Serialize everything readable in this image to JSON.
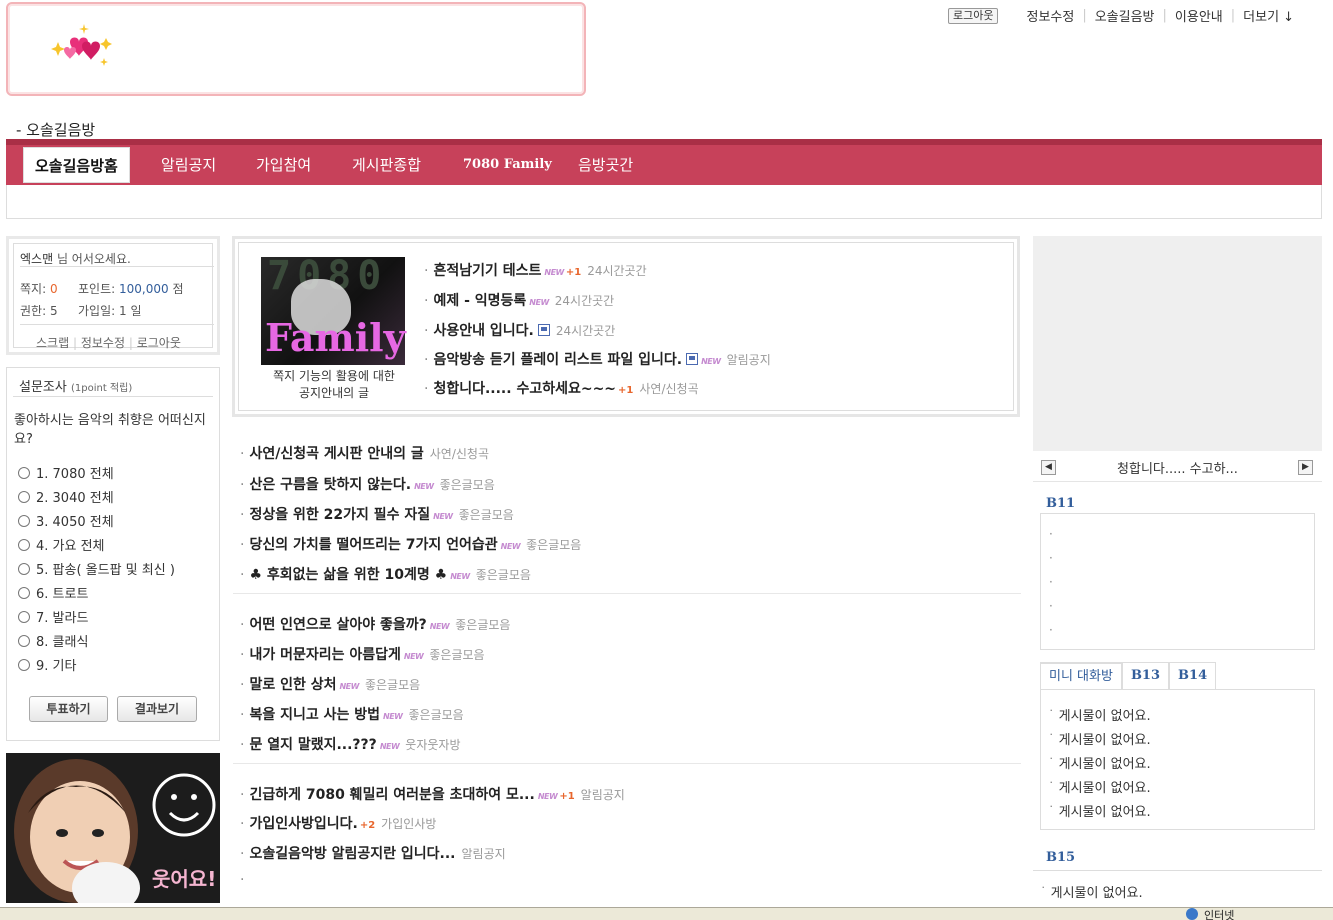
{
  "topnav": {
    "logout": "로그아웃",
    "links": [
      "정보수정",
      "오솔길음방",
      "이용안내",
      "더보기 ↓"
    ]
  },
  "cafe_title": "- 오솔길음방",
  "menu": [
    "오솔길음방홈",
    "알림공지",
    "가입참여",
    "게시판종합",
    "7080 Family",
    "음방곳간"
  ],
  "login": {
    "greeting_name": "엑스맨",
    "greeting_rest": " 님 어서오세요.",
    "note_label": "쪽지:",
    "note_value": "0",
    "point_label": "포인트:",
    "point_value": "100,000",
    "point_unit": "점",
    "rank_label": "권한:",
    "rank_value": "5",
    "join_label": "가입일:",
    "join_value": "1 일",
    "links": [
      "스크랩",
      "정보수정",
      "로그아웃"
    ]
  },
  "poll": {
    "title": "설문조사",
    "title_note": "(1point 적립)",
    "question": "좋아하시는 음악의 취향은 어떠신지요?",
    "options": [
      "1. 7080 전체",
      "2. 3040 전체",
      "3. 4050 전체",
      "4. 가요 전체",
      "5. 팝송( 올드팝 및 최신 )",
      "6. 트로트",
      "7. 발라드",
      "8. 클래식",
      "9. 기타"
    ],
    "vote_button": "투표하기",
    "result_button": "결과보기"
  },
  "smile_caption": "웃어요!",
  "family_image": {
    "line1": "7080",
    "line2": "Family",
    "caption": "쪽지 기능의 활용에 대한 공지안내의 글"
  },
  "notice_posts": [
    {
      "title": "흔적남기기 테스트",
      "new": "NEW",
      "count": "+1",
      "category": "24시간곳간"
    },
    {
      "title": "예제 - 익명등록",
      "new": "NEW",
      "count": "",
      "category": "24시간곳간"
    },
    {
      "title": "사용안내 입니다.",
      "new": "",
      "count": "",
      "category": "24시간곳간"
    },
    {
      "title": "음악방송 듣기 플레이 리스트 파일 입니다.",
      "new": "NEW",
      "count": "",
      "category": "알림공지"
    },
    {
      "title": "청합니다..... 수고하세요~~~",
      "new": "",
      "count": "+1",
      "category": "사연/신청곡"
    }
  ],
  "list1": [
    {
      "title": "사연/신청곡 게시판 안내의 글",
      "new": "",
      "count": "",
      "category": "사연/신청곡"
    },
    {
      "title": "산은 구름을 탓하지 않는다.",
      "new": "NEW",
      "count": "",
      "category": "좋은글모음"
    },
    {
      "title": "정상을 위한 22가지 필수 자질",
      "new": "NEW",
      "count": "",
      "category": "좋은글모음"
    },
    {
      "title": "당신의 가치를 떨어뜨리는 7가지 언어습관",
      "new": "NEW",
      "count": "",
      "category": "좋은글모음"
    },
    {
      "title": "♣ 후회없는 삶을 위한 10계명 ♣",
      "new": "NEW",
      "count": "",
      "category": "좋은글모음"
    }
  ],
  "list2": [
    {
      "title": "어떤 인연으로 살아야 좋을까?",
      "new": "NEW",
      "count": "",
      "category": "좋은글모음"
    },
    {
      "title": "내가 머문자리는 아름답게",
      "new": "NEW",
      "count": "",
      "category": "좋은글모음"
    },
    {
      "title": "말로 인한 상처",
      "new": "NEW",
      "count": "",
      "category": "좋은글모음"
    },
    {
      "title": "복을 지니고 사는 방법",
      "new": "NEW",
      "count": "",
      "category": "좋은글모음"
    },
    {
      "title": "문 열지 말랬지...???",
      "new": "NEW",
      "count": "",
      "category": "웃자웃자방"
    }
  ],
  "list3": [
    {
      "title": "긴급하게 7080 훼밀리 여러분을 초대하여 모...",
      "new": "NEW",
      "count": "+1",
      "category": "알림공지"
    },
    {
      "title": "가입인사방입니다.",
      "new": "",
      "count": "+2",
      "category": "가입인사방"
    },
    {
      "title": "오솔길음악방 알림공지란 입니다...",
      "new": "",
      "count": "",
      "category": "알림공지"
    },
    {
      "title": "",
      "new": "",
      "count": "",
      "category": ""
    }
  ],
  "roll": {
    "text": "청합니다..... 수고하..."
  },
  "b11": {
    "title": "B11"
  },
  "mini_tabs": [
    "미니 대화방",
    "B13",
    "B14"
  ],
  "mini_rows": [
    "게시물이 없어요.",
    "게시물이 없어요.",
    "게시물이 없어요.",
    "게시물이 없어요.",
    "게시물이 없어요."
  ],
  "b15": {
    "title": "B15",
    "row": "게시물이 없어요."
  },
  "statusbar": {
    "zone": "인터넷"
  }
}
